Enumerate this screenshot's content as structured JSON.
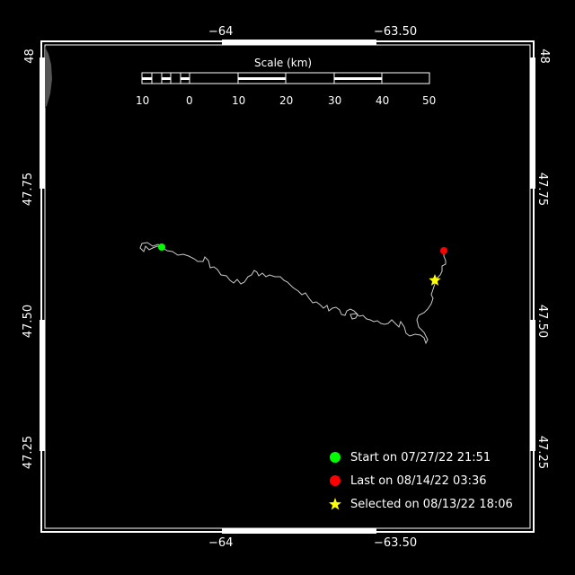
{
  "axes": {
    "x_ticks": [
      "−64",
      "−63.50"
    ],
    "y_ticks": [
      "48",
      "47.75",
      "47.50",
      "47.25"
    ]
  },
  "scale_bar": {
    "title": "Scale (km)",
    "labels": [
      "10",
      "0",
      "10",
      "20",
      "30",
      "40",
      "50"
    ]
  },
  "legend": [
    {
      "label": "Start on 07/27/22 21:51",
      "color": "#00ff00",
      "symbol": "circle-icon"
    },
    {
      "label": "Last on 08/14/22 03:36",
      "color": "#ff0000",
      "symbol": "circle-icon"
    },
    {
      "label": "Selected on 08/13/22 18:06",
      "color": "#ffff00",
      "symbol": "star-icon"
    }
  ],
  "colors": {
    "background": "#000000",
    "frame": "#ffffff",
    "track": "#cccccc",
    "land": "#555555"
  }
}
